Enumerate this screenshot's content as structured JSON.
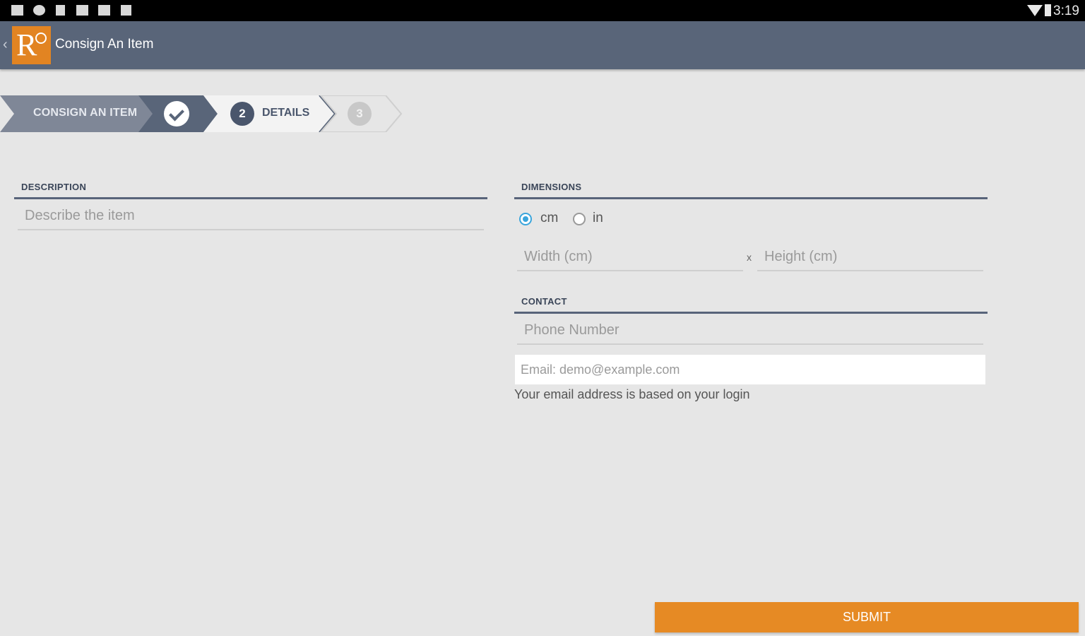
{
  "status_bar": {
    "time": "3:19"
  },
  "app_bar": {
    "back_glyph": "‹",
    "logo_text": "R",
    "title": "Consign An Item"
  },
  "stepper": {
    "step1_label": "CONSIGN AN ITEM",
    "step2_number": "2",
    "step2_label": "DETAILS",
    "step3_number": "3"
  },
  "description": {
    "header": "DESCRIPTION",
    "placeholder": "Describe the item"
  },
  "dimensions": {
    "header": "DIMENSIONS",
    "units": [
      {
        "label": "cm",
        "selected": true
      },
      {
        "label": "in",
        "selected": false
      }
    ],
    "width_placeholder": "Width (cm)",
    "separator": "x",
    "height_placeholder": "Height (cm)"
  },
  "contact": {
    "header": "CONTACT",
    "phone_placeholder": "Phone Number",
    "email_placeholder": "Email: demo@example.com",
    "email_hint": "Your email address is based on your login"
  },
  "submit_label": "SUBMIT",
  "colors": {
    "app_bar": "#596579",
    "accent": "#e68a24",
    "radio_selected": "#3aa5dc"
  }
}
